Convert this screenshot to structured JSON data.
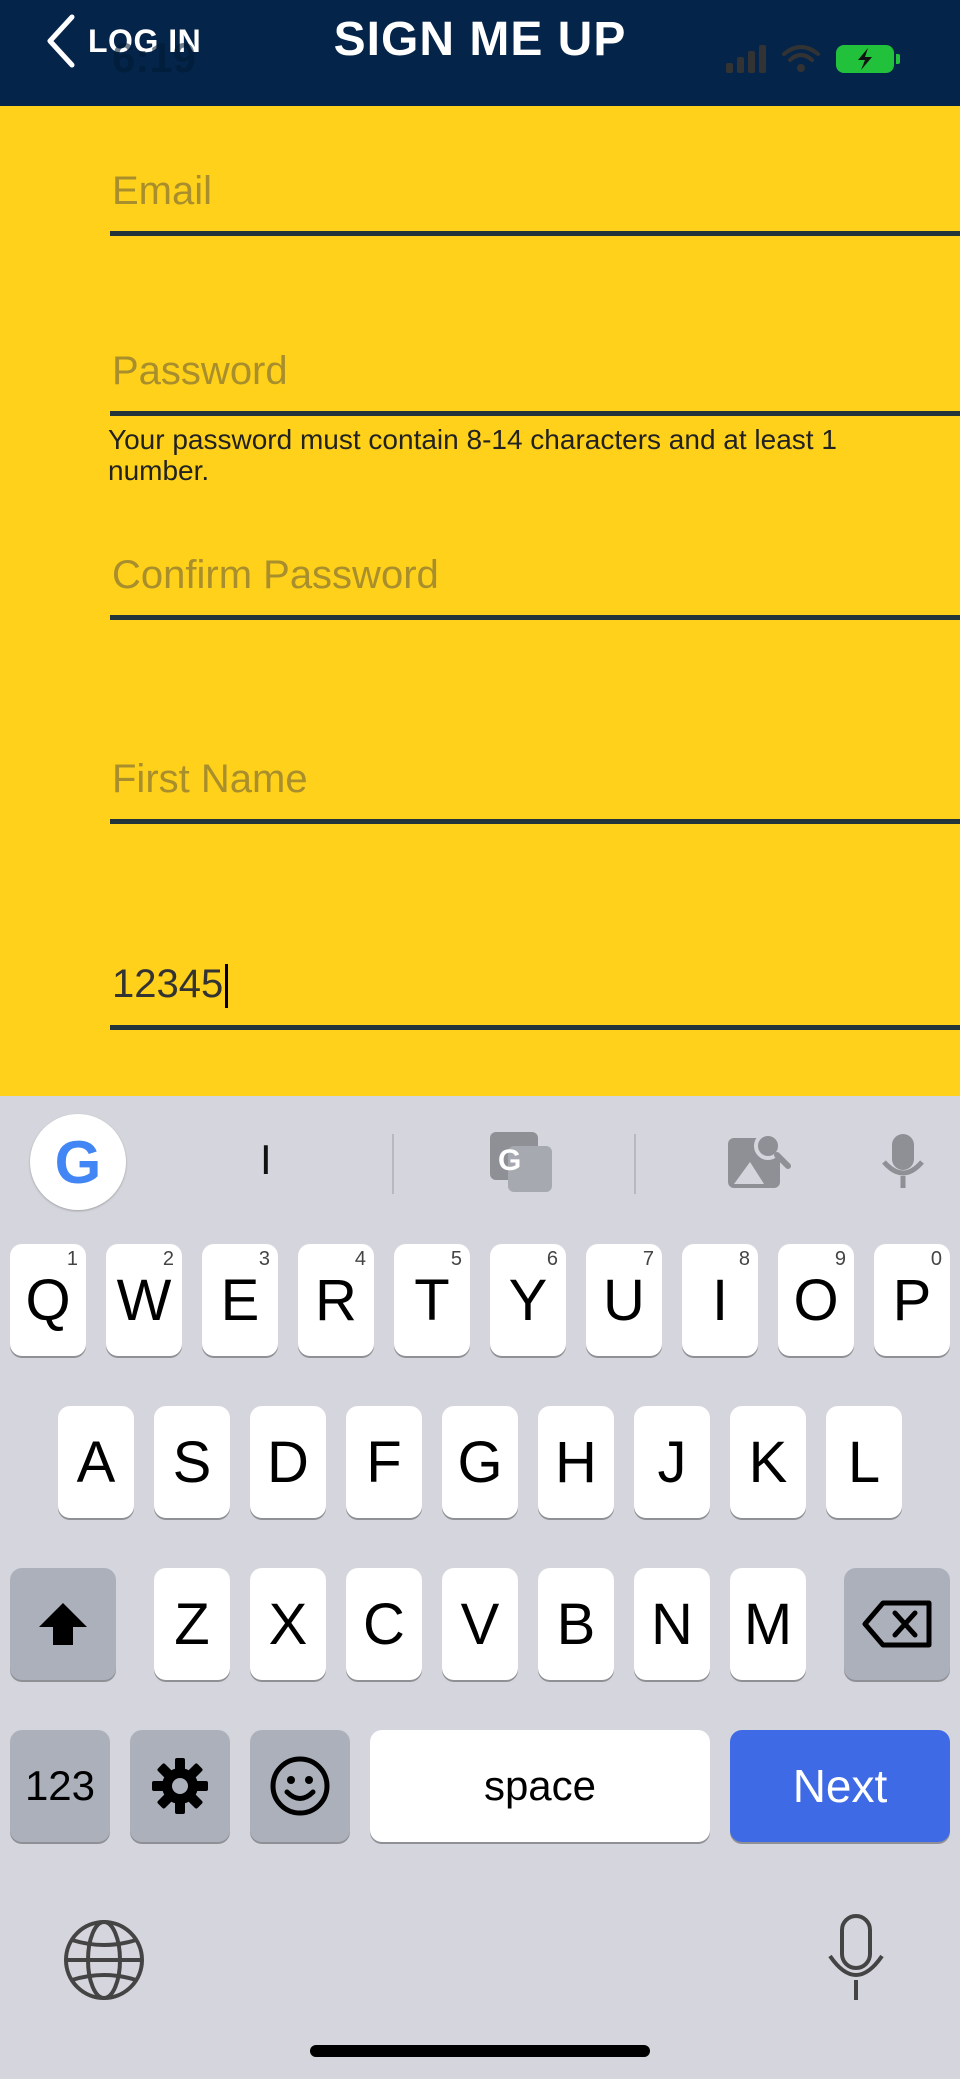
{
  "header": {
    "back_label": "LOG IN",
    "title": "SIGN ME UP",
    "time": "6:19"
  },
  "form": {
    "email_placeholder": "Email",
    "password_placeholder": "Password",
    "password_hint": "Your password must contain 8-14 characters and at least 1 number.",
    "confirm_placeholder": "Confirm Password",
    "first_name_placeholder": "First Name",
    "zip_value": "12345"
  },
  "keyboard": {
    "suggestion": "I",
    "row1": [
      "Q",
      "W",
      "E",
      "R",
      "T",
      "Y",
      "U",
      "I",
      "O",
      "P"
    ],
    "row1_hints": [
      "1",
      "2",
      "3",
      "4",
      "5",
      "6",
      "7",
      "8",
      "9",
      "0"
    ],
    "row2": [
      "A",
      "S",
      "D",
      "F",
      "G",
      "H",
      "J",
      "K",
      "L"
    ],
    "row3": [
      "Z",
      "X",
      "C",
      "V",
      "B",
      "N",
      "M"
    ],
    "numbers_key": "123",
    "space_key": "space",
    "next_key": "Next"
  },
  "colors": {
    "background": "#ffd11a",
    "header": "#05244a",
    "next": "#3e6ae6"
  }
}
